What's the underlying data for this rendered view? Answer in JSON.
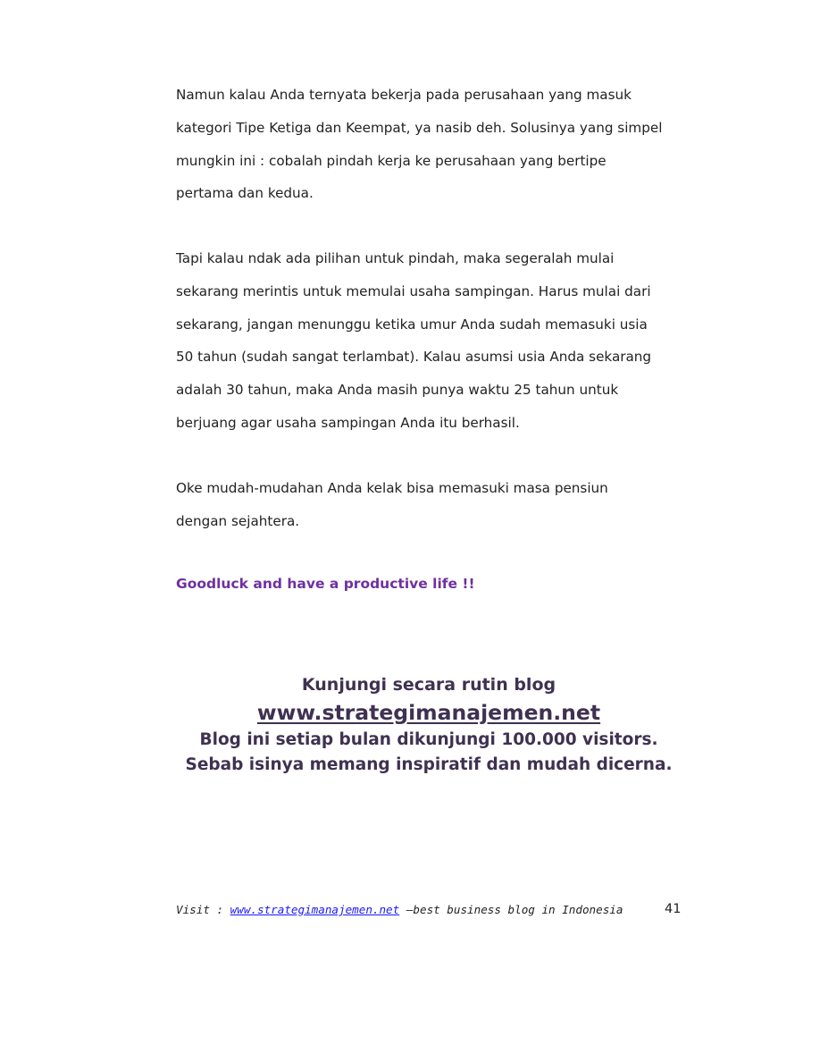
{
  "paragraphs": [
    {
      "lines": [
        "Namun kalau Anda ternyata bekerja pada perusahaan yang masuk",
        "kategori Tipe Ketiga dan Keempat, ya nasib deh. Solusinya yang simpel",
        "mungkin ini : cobalah pindah kerja ke perusahaan yang bertipe",
        "pertama dan kedua."
      ]
    },
    {
      "lines": [
        "Tapi kalau ndak ada pilihan untuk pindah, maka segeralah mulai",
        "sekarang merintis untuk memulai usaha sampingan. Harus mulai dari",
        "sekarang, jangan menunggu ketika umur Anda sudah memasuki usia",
        "50 tahun (sudah sangat terlambat). Kalau asumsi usia Anda sekarang",
        "adalah 30 tahun, maka Anda masih punya waktu 25 tahun untuk",
        "berjuang agar usaha sampingan Anda itu berhasil."
      ]
    },
    {
      "lines": [
        "Oke mudah-mudahan Anda kelak bisa memasuki masa pensiun",
        "dengan sejahtera."
      ]
    }
  ],
  "closing": "Goodluck and have a productive life !!",
  "promo": {
    "line1": "Kunjungi secara rutin blog",
    "url": "www.strategimanajemen.net",
    "line3": "Blog ini setiap bulan dikunjungi 100.000 visitors.",
    "line4": "Sebab isinya memang inspiratif dan mudah dicerna."
  },
  "footer": {
    "prefix": "Visit : ",
    "link": "www.strategimanajemen.net",
    "suffix": " –best business blog in Indonesia",
    "page_number": "41"
  },
  "colors": {
    "body_text": "#222222",
    "closing": "#7030a0",
    "promo": "#3f3151",
    "footer_link": "#1a1aee"
  }
}
